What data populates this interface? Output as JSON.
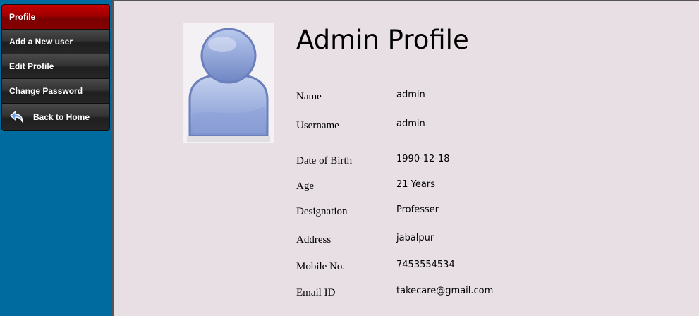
{
  "sidebar": {
    "items": [
      {
        "label": "Profile",
        "active": true
      },
      {
        "label": "Add a New user",
        "active": false
      },
      {
        "label": "Edit Profile",
        "active": false
      },
      {
        "label": "Change Password",
        "active": false
      },
      {
        "label": "Back to Home",
        "icon": "back-arrow-icon",
        "active": false
      }
    ]
  },
  "colors": {
    "background": "#006b9e",
    "content_bg": "#e7dfe3",
    "active_nav": "#a00000",
    "nav": "#2a2a2a"
  },
  "profile": {
    "title": "Admin Profile",
    "avatar_icon": "user-silhouette-icon",
    "fields": [
      {
        "label": "Name",
        "value": "admin"
      },
      {
        "label": "Username",
        "value": "admin"
      },
      {
        "label": "Date of Birth",
        "value": "1990-12-18"
      },
      {
        "label": "Age",
        "value": "21 Years"
      },
      {
        "label": "Designation",
        "value": "Professer"
      },
      {
        "label": "Address",
        "value": "jabalpur"
      },
      {
        "label": "Mobile No.",
        "value": "7453554534"
      },
      {
        "label": "Email ID",
        "value": "takecare@gmail.com"
      }
    ]
  }
}
